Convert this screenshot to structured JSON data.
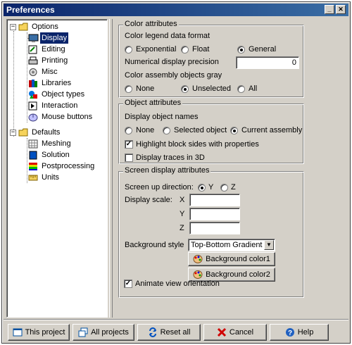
{
  "window": {
    "title": "Preferences",
    "minimize_glyph": "_",
    "close_glyph": "✕"
  },
  "tree": {
    "expand_glyph": "−",
    "options": {
      "label": "Options",
      "children": [
        {
          "label": "Display",
          "icon": "monitor-icon"
        },
        {
          "label": "Editing",
          "icon": "editing-icon"
        },
        {
          "label": "Printing",
          "icon": "printer-icon"
        },
        {
          "label": "Misc",
          "icon": "misc-icon"
        },
        {
          "label": "Libraries",
          "icon": "libraries-icon"
        },
        {
          "label": "Object types",
          "icon": "object-types-icon"
        },
        {
          "label": "Interaction",
          "icon": "interaction-icon"
        },
        {
          "label": "Mouse buttons",
          "icon": "mouse-icon"
        }
      ]
    },
    "defaults": {
      "label": "Defaults",
      "children": [
        {
          "label": "Meshing",
          "icon": "mesh-icon"
        },
        {
          "label": "Solution",
          "icon": "solution-icon"
        },
        {
          "label": "Postprocessing",
          "icon": "postprocessing-icon"
        },
        {
          "label": "Units",
          "icon": "units-icon"
        }
      ]
    },
    "selected": "Display"
  },
  "color_attributes": {
    "title": "Color attributes",
    "legend_format_label": "Color legend data format",
    "legend_options": [
      "Exponential",
      "Float",
      "General"
    ],
    "legend_selected": "General",
    "precision_label": "Numerical display precision",
    "precision_value": "0",
    "gray_label": "Color assembly objects gray",
    "gray_options": [
      "None",
      "Unselected",
      "All"
    ],
    "gray_selected": "Unselected"
  },
  "object_attributes": {
    "title": "Object attributes",
    "names_label": "Display object names",
    "names_options": [
      "None",
      "Selected object",
      "Current assembly"
    ],
    "names_selected": "Current assembly",
    "highlight_label": "Highlight block sides with properties",
    "highlight_checked": true,
    "traces_label": "Display traces in 3D",
    "traces_checked": false,
    "check_glyph": "✓"
  },
  "screen_attributes": {
    "title": "Screen display attributes",
    "up_label": "Screen up direction:",
    "up_options": [
      "Y",
      "Z"
    ],
    "up_selected": "Y",
    "scale_label": "Display scale:",
    "scale_axes": [
      "X",
      "Y",
      "Z"
    ],
    "scale_values": [
      "",
      "",
      ""
    ],
    "bg_style_label": "Background style",
    "bg_style_value": "Top-Bottom Gradient",
    "dropdown_glyph": "▼",
    "bg_color1_label": "Background color1",
    "bg_color2_label": "Background color2",
    "animate_label": "Animate view orientation",
    "animate_checked": true
  },
  "footer": {
    "this_project": "This project",
    "all_projects": "All projects",
    "reset_all": "Reset all",
    "cancel": "Cancel",
    "help": "Help"
  },
  "colors": {
    "title_start": "#0a246a",
    "title_end": "#3a6ea5",
    "face": "#d4d0c8",
    "selection": "#0a246a"
  }
}
